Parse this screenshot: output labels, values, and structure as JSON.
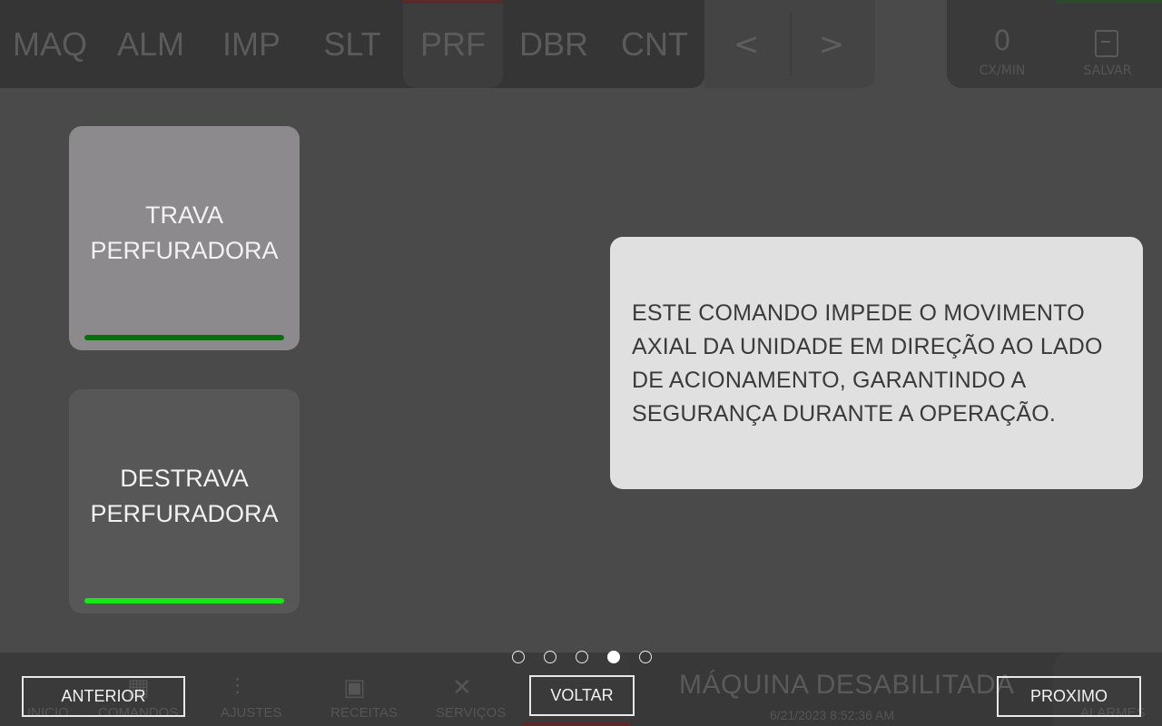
{
  "header": {
    "tabs": [
      {
        "label": "MAQ",
        "active": false
      },
      {
        "label": "ALM",
        "active": false
      },
      {
        "label": "IMP",
        "active": false
      },
      {
        "label": "SLT",
        "active": false
      },
      {
        "label": "PRF",
        "active": true
      },
      {
        "label": "DBR",
        "active": false
      },
      {
        "label": "CNT",
        "active": false
      }
    ],
    "prev_arrow": "<",
    "next_arrow": ">",
    "rate_value": "0",
    "rate_label": "CX/MIN",
    "save_label": "SALVAR"
  },
  "commands": {
    "lock_label": "TRAVA\nPERFURADORA",
    "unlock_label": "DESTRAVA\nPERFURADORA"
  },
  "info": {
    "text": "ESTE COMANDO IMPEDE O MOVIMENTO AXIAL DA UNIDADE EM DIREÇÃO AO LADO DE ACIONAMENTO, GARANTINDO A SEGURANÇA DURANTE A OPERAÇÃO."
  },
  "pager": {
    "total": 5,
    "active_index": 3
  },
  "footer": {
    "nav": [
      {
        "label": "INICIO",
        "icon": "home-icon"
      },
      {
        "label": "COMANDOS",
        "icon": "grid-icon"
      },
      {
        "label": "AJUSTES",
        "icon": "sliders-icon"
      },
      {
        "label": "RECEITAS",
        "icon": "recipes-icon"
      },
      {
        "label": "SERVIÇOS",
        "icon": "tools-icon"
      }
    ],
    "status": "MÁQUINA DESABILITADA",
    "timestamp": "6/21/2023 8:52:36 AM",
    "alarm_label": "ALARMES",
    "btn_prev": "ANTERIOR",
    "btn_back": "VOLTAR",
    "btn_next": "PROXIMO"
  },
  "colors": {
    "background": "#4a4a4a",
    "lock_indicator": "#0d6e0d",
    "unlock_indicator": "#19e619",
    "info_box": "#e0e0e0"
  }
}
